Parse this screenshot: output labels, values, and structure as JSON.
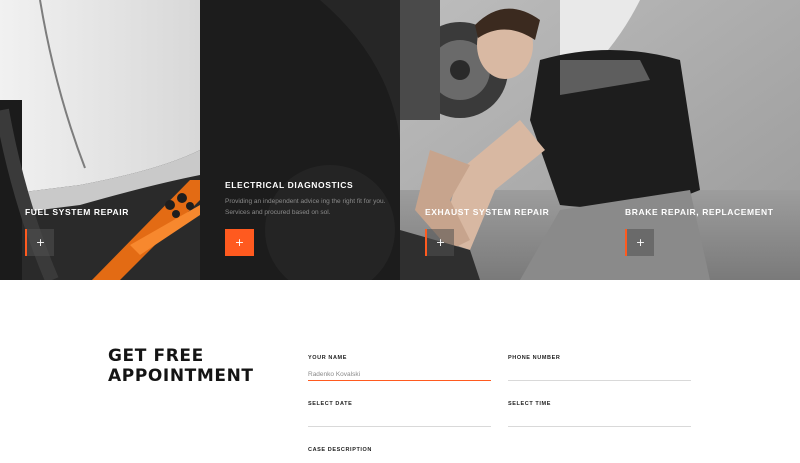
{
  "services": [
    {
      "title": "FUEL SYSTEM REPAIR",
      "button": "+"
    },
    {
      "title": "ELECTRICAL DIAGNOSTICS",
      "description": "Providing an independent advice ing the right fit for you. Services and procured based on sol.",
      "button": "+"
    },
    {
      "title": "EXHAUST SYSTEM REPAIR",
      "button": "+"
    },
    {
      "title": "BRAKE REPAIR, REPLACEMENT",
      "button": "+"
    }
  ],
  "appointment": {
    "heading": "GET FREE APPOINTMENT",
    "fields": {
      "name": {
        "label": "YOUR NAME",
        "value": "Radenko Kovalski"
      },
      "phone": {
        "label": "PHONE NUMBER",
        "value": ""
      },
      "date": {
        "label": "SELECT DATE",
        "value": ""
      },
      "time": {
        "label": "SELECT TIME",
        "value": ""
      },
      "description": {
        "label": "CASE DESCRIPTION",
        "value": ""
      }
    }
  },
  "colors": {
    "accent": "#ff5a1f",
    "dark_panel": "#1e1e1e",
    "text_dark": "#141414"
  }
}
